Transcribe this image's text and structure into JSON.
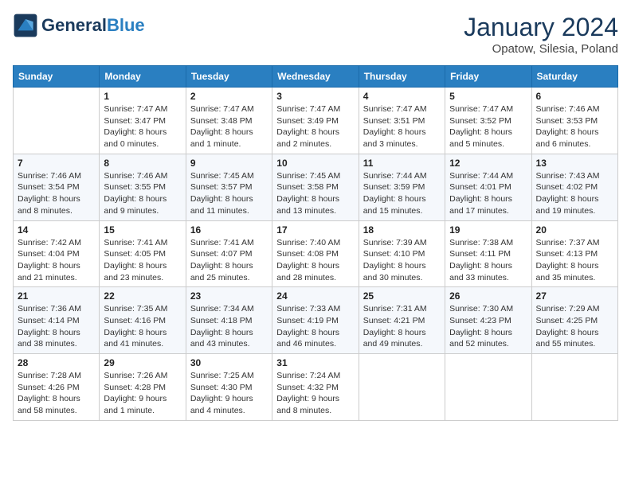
{
  "header": {
    "logo_general": "General",
    "logo_blue": "Blue",
    "month": "January 2024",
    "location": "Opatow, Silesia, Poland"
  },
  "weekdays": [
    "Sunday",
    "Monday",
    "Tuesday",
    "Wednesday",
    "Thursday",
    "Friday",
    "Saturday"
  ],
  "weeks": [
    [
      {
        "day": "",
        "info": ""
      },
      {
        "day": "1",
        "info": "Sunrise: 7:47 AM\nSunset: 3:47 PM\nDaylight: 8 hours\nand 0 minutes."
      },
      {
        "day": "2",
        "info": "Sunrise: 7:47 AM\nSunset: 3:48 PM\nDaylight: 8 hours\nand 1 minute."
      },
      {
        "day": "3",
        "info": "Sunrise: 7:47 AM\nSunset: 3:49 PM\nDaylight: 8 hours\nand 2 minutes."
      },
      {
        "day": "4",
        "info": "Sunrise: 7:47 AM\nSunset: 3:51 PM\nDaylight: 8 hours\nand 3 minutes."
      },
      {
        "day": "5",
        "info": "Sunrise: 7:47 AM\nSunset: 3:52 PM\nDaylight: 8 hours\nand 5 minutes."
      },
      {
        "day": "6",
        "info": "Sunrise: 7:46 AM\nSunset: 3:53 PM\nDaylight: 8 hours\nand 6 minutes."
      }
    ],
    [
      {
        "day": "7",
        "info": "Sunrise: 7:46 AM\nSunset: 3:54 PM\nDaylight: 8 hours\nand 8 minutes."
      },
      {
        "day": "8",
        "info": "Sunrise: 7:46 AM\nSunset: 3:55 PM\nDaylight: 8 hours\nand 9 minutes."
      },
      {
        "day": "9",
        "info": "Sunrise: 7:45 AM\nSunset: 3:57 PM\nDaylight: 8 hours\nand 11 minutes."
      },
      {
        "day": "10",
        "info": "Sunrise: 7:45 AM\nSunset: 3:58 PM\nDaylight: 8 hours\nand 13 minutes."
      },
      {
        "day": "11",
        "info": "Sunrise: 7:44 AM\nSunset: 3:59 PM\nDaylight: 8 hours\nand 15 minutes."
      },
      {
        "day": "12",
        "info": "Sunrise: 7:44 AM\nSunset: 4:01 PM\nDaylight: 8 hours\nand 17 minutes."
      },
      {
        "day": "13",
        "info": "Sunrise: 7:43 AM\nSunset: 4:02 PM\nDaylight: 8 hours\nand 19 minutes."
      }
    ],
    [
      {
        "day": "14",
        "info": "Sunrise: 7:42 AM\nSunset: 4:04 PM\nDaylight: 8 hours\nand 21 minutes."
      },
      {
        "day": "15",
        "info": "Sunrise: 7:41 AM\nSunset: 4:05 PM\nDaylight: 8 hours\nand 23 minutes."
      },
      {
        "day": "16",
        "info": "Sunrise: 7:41 AM\nSunset: 4:07 PM\nDaylight: 8 hours\nand 25 minutes."
      },
      {
        "day": "17",
        "info": "Sunrise: 7:40 AM\nSunset: 4:08 PM\nDaylight: 8 hours\nand 28 minutes."
      },
      {
        "day": "18",
        "info": "Sunrise: 7:39 AM\nSunset: 4:10 PM\nDaylight: 8 hours\nand 30 minutes."
      },
      {
        "day": "19",
        "info": "Sunrise: 7:38 AM\nSunset: 4:11 PM\nDaylight: 8 hours\nand 33 minutes."
      },
      {
        "day": "20",
        "info": "Sunrise: 7:37 AM\nSunset: 4:13 PM\nDaylight: 8 hours\nand 35 minutes."
      }
    ],
    [
      {
        "day": "21",
        "info": "Sunrise: 7:36 AM\nSunset: 4:14 PM\nDaylight: 8 hours\nand 38 minutes."
      },
      {
        "day": "22",
        "info": "Sunrise: 7:35 AM\nSunset: 4:16 PM\nDaylight: 8 hours\nand 41 minutes."
      },
      {
        "day": "23",
        "info": "Sunrise: 7:34 AM\nSunset: 4:18 PM\nDaylight: 8 hours\nand 43 minutes."
      },
      {
        "day": "24",
        "info": "Sunrise: 7:33 AM\nSunset: 4:19 PM\nDaylight: 8 hours\nand 46 minutes."
      },
      {
        "day": "25",
        "info": "Sunrise: 7:31 AM\nSunset: 4:21 PM\nDaylight: 8 hours\nand 49 minutes."
      },
      {
        "day": "26",
        "info": "Sunrise: 7:30 AM\nSunset: 4:23 PM\nDaylight: 8 hours\nand 52 minutes."
      },
      {
        "day": "27",
        "info": "Sunrise: 7:29 AM\nSunset: 4:25 PM\nDaylight: 8 hours\nand 55 minutes."
      }
    ],
    [
      {
        "day": "28",
        "info": "Sunrise: 7:28 AM\nSunset: 4:26 PM\nDaylight: 8 hours\nand 58 minutes."
      },
      {
        "day": "29",
        "info": "Sunrise: 7:26 AM\nSunset: 4:28 PM\nDaylight: 9 hours\nand 1 minute."
      },
      {
        "day": "30",
        "info": "Sunrise: 7:25 AM\nSunset: 4:30 PM\nDaylight: 9 hours\nand 4 minutes."
      },
      {
        "day": "31",
        "info": "Sunrise: 7:24 AM\nSunset: 4:32 PM\nDaylight: 9 hours\nand 8 minutes."
      },
      {
        "day": "",
        "info": ""
      },
      {
        "day": "",
        "info": ""
      },
      {
        "day": "",
        "info": ""
      }
    ]
  ]
}
